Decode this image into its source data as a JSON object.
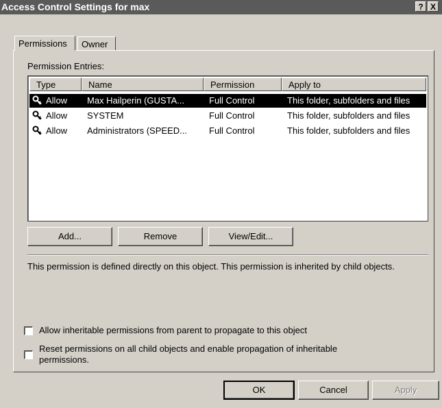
{
  "window": {
    "title": "Access Control Settings for max",
    "help_button": "?",
    "close_button": "X"
  },
  "tabs": [
    {
      "label": "Permissions",
      "active": true
    },
    {
      "label": "Owner",
      "active": false
    }
  ],
  "permission_entries": {
    "label": "Permission Entries:",
    "columns": [
      "Type",
      "Name",
      "Permission",
      "Apply to"
    ],
    "rows": [
      {
        "type": "Allow",
        "name": "Max Hailperin (GUSTA...",
        "permission": "Full Control",
        "apply_to": "This folder, subfolders and files",
        "selected": true
      },
      {
        "type": "Allow",
        "name": "SYSTEM",
        "permission": "Full Control",
        "apply_to": "This folder, subfolders and files",
        "selected": false
      },
      {
        "type": "Allow",
        "name": "Administrators (SPEED...",
        "permission": "Full Control",
        "apply_to": "This folder, subfolders and files",
        "selected": false
      }
    ]
  },
  "list_buttons": {
    "add": "Add...",
    "remove": "Remove",
    "view_edit": "View/Edit..."
  },
  "description": "This permission is defined directly on this object. This permission is inherited by child objects.",
  "checkboxes": {
    "inherit_label": "Allow inheritable permissions from parent to propagate to this object",
    "inherit_checked": false,
    "reset_label_line1": "Reset permissions on all child objects and enable propagation of inheritable",
    "reset_label_line2": "permissions.",
    "reset_checked": false
  },
  "dialog_buttons": {
    "ok": "OK",
    "cancel": "Cancel",
    "apply": "Apply",
    "apply_enabled": false
  },
  "icons": {
    "entry_icon": "key-icon"
  },
  "colors": {
    "face": "#d4d0c8",
    "titlebar": "#5a5a5a",
    "selection": "#000000"
  }
}
